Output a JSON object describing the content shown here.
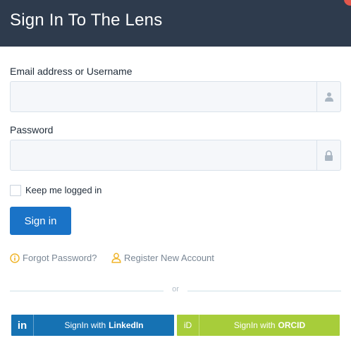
{
  "header": {
    "title": "Sign In To The Lens"
  },
  "form": {
    "email_label": "Email address or Username",
    "email_value": "",
    "email_placeholder": "",
    "password_label": "Password",
    "password_value": "",
    "password_placeholder": "",
    "keep_logged_in_label": "Keep me logged in",
    "keep_logged_in_checked": false,
    "signin_label": "Sign in"
  },
  "links": {
    "forgot_password": "Forgot Password?",
    "register": "Register New Account"
  },
  "divider": {
    "text": "or"
  },
  "social": {
    "linkedin_prefix": "SignIn with",
    "linkedin_name": "LinkedIn",
    "linkedin_icon": "in",
    "orcid_prefix": "SignIn with",
    "orcid_name": "ORCID",
    "orcid_icon": "iD"
  },
  "icons": {
    "user": "user-icon",
    "lock": "lock-icon",
    "info": "info-circle-icon",
    "person": "person-outline-icon"
  },
  "colors": {
    "header_bg": "#2e3b4d",
    "primary": "#1a73c7",
    "linkedin": "#1672b3",
    "orcid": "#a7cd3a",
    "link_icon": "#f0b429"
  }
}
